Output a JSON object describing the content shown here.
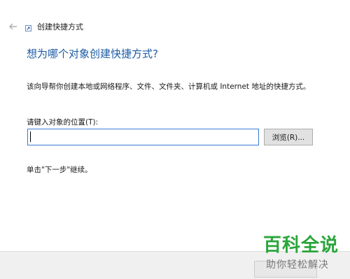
{
  "header": {
    "back_icon": "back-arrow-icon",
    "title_icon": "shortcut-icon",
    "title": "创建快捷方式"
  },
  "main": {
    "heading": "想为哪个对象创建快捷方式?",
    "description": "该向导帮你创建本地或网络程序、文件、文件夹、计算机或 Internet 地址的快捷方式。",
    "location_label": "请键入对象的位置(T):",
    "location_value": "",
    "browse_label": "浏览(R)...",
    "hint": "单击\"下一步\"继续。"
  },
  "watermark": {
    "main": "百科全说",
    "sub": "助你轻松解决"
  },
  "colors": {
    "heading": "#1c5ba6",
    "input_border_focus": "#3a7bd5",
    "watermark_main": "#2aa53a"
  }
}
